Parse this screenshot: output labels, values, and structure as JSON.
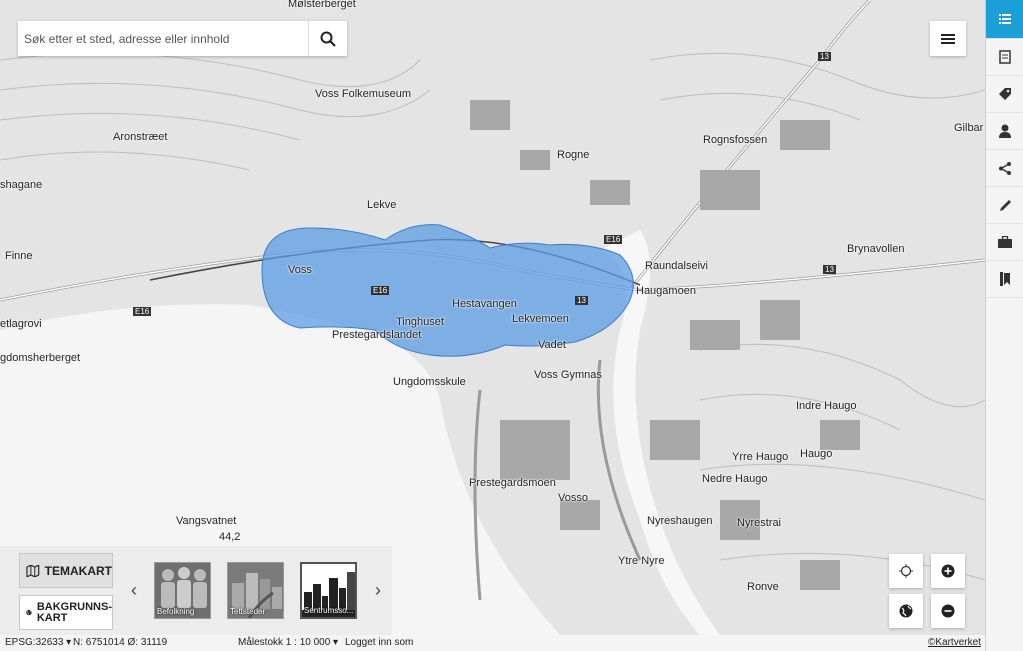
{
  "search": {
    "placeholder": "Søk etter et sted, adresse eller innhold"
  },
  "map": {
    "highlight_color": "#5b9ee6",
    "places": [
      {
        "name": "Mølsterberget"
      },
      {
        "name": "Voss Folkemuseum"
      },
      {
        "name": "Aronstræet"
      },
      {
        "name": "shagane"
      },
      {
        "name": "Finne"
      },
      {
        "name": "etlagrovi"
      },
      {
        "name": "gdomsherberget"
      },
      {
        "name": "Lekve"
      },
      {
        "name": "Rogne"
      },
      {
        "name": "Rognsfossen"
      },
      {
        "name": "Gilbar"
      },
      {
        "name": "Voss"
      },
      {
        "name": "Hestavangen"
      },
      {
        "name": "Tinghuset"
      },
      {
        "name": "Prestegardslandet"
      },
      {
        "name": "Lekvemoen"
      },
      {
        "name": "Vadet"
      },
      {
        "name": "Voss Gymnas"
      },
      {
        "name": "Ungdomsskule"
      },
      {
        "name": "Raundalseivi"
      },
      {
        "name": "Haugamoen"
      },
      {
        "name": "Brynavollen"
      },
      {
        "name": "Indre Haugo"
      },
      {
        "name": "Yrre Haugo"
      },
      {
        "name": "Haugo"
      },
      {
        "name": "Nedre Haugo"
      },
      {
        "name": "Prestegardsmoen"
      },
      {
        "name": "Vosso"
      },
      {
        "name": "Nyreshaugen"
      },
      {
        "name": "Nyrestrai"
      },
      {
        "name": "Ytre Nyre"
      },
      {
        "name": "Ronve"
      },
      {
        "name": "Vangsvatnet"
      },
      {
        "name": "44,2"
      }
    ],
    "road_labels": [
      "E16",
      "E16",
      "E16",
      "13",
      "13",
      "13"
    ]
  },
  "sidebar": {
    "items": [
      {
        "icon": "list-icon",
        "active": true
      },
      {
        "icon": "document-icon"
      },
      {
        "icon": "tag-icon"
      },
      {
        "icon": "user-icon"
      },
      {
        "icon": "share-icon"
      },
      {
        "icon": "pencil-icon"
      },
      {
        "icon": "briefcase-icon"
      },
      {
        "icon": "bookmark-icon"
      }
    ]
  },
  "temakart_label": "TEMAKART",
  "bakgrunnskart_label_1": "BAKGRUNNS-",
  "bakgrunnskart_label_2": "KART",
  "carousel": {
    "prev": "‹",
    "next": "›",
    "items": [
      {
        "label": "Befolkning"
      },
      {
        "label": "Tettsteder"
      },
      {
        "label": "Sentrumsso..."
      }
    ]
  },
  "status": {
    "epsg": "EPSG:32633 ▾",
    "coords": "N: 6751014 Ø: 31119",
    "scale": "Målestokk 1 : 10 000 ▾",
    "login": "Logget inn som",
    "copyright": "©Kartverket"
  }
}
